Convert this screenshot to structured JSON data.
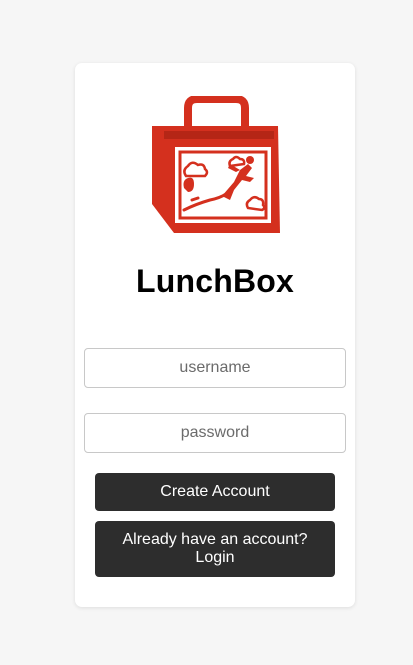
{
  "app": {
    "title": "LunchBox",
    "brand_color": "#d4301e",
    "logo_icon": "lunchbox-icon"
  },
  "form": {
    "username_placeholder": "username",
    "password_placeholder": "password",
    "create_account_label": "Create Account",
    "login_label": "Already have an account? Login"
  }
}
